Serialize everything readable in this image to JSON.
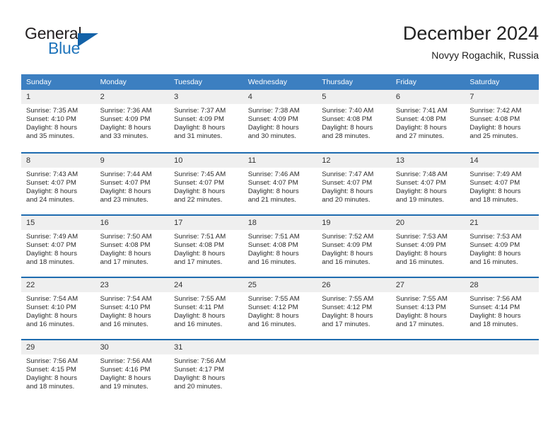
{
  "brand": {
    "name_top": "General",
    "name_bottom": "Blue",
    "accent_color": "#1f74bb",
    "triangle_color": "#1362a8"
  },
  "header": {
    "title": "December 2024",
    "subtitle": "Novyy Rogachik, Russia"
  },
  "theme": {
    "header_row_bg": "#3c7fc1",
    "week_divider": "#1f6cb0",
    "daynum_bg": "#efefef",
    "text": "#2b2b2b"
  },
  "weekdays": [
    "Sunday",
    "Monday",
    "Tuesday",
    "Wednesday",
    "Thursday",
    "Friday",
    "Saturday"
  ],
  "weeks": [
    [
      {
        "day": "1",
        "sunrise": "Sunrise: 7:35 AM",
        "sunset": "Sunset: 4:10 PM",
        "daylight1": "Daylight: 8 hours",
        "daylight2": "and 35 minutes."
      },
      {
        "day": "2",
        "sunrise": "Sunrise: 7:36 AM",
        "sunset": "Sunset: 4:09 PM",
        "daylight1": "Daylight: 8 hours",
        "daylight2": "and 33 minutes."
      },
      {
        "day": "3",
        "sunrise": "Sunrise: 7:37 AM",
        "sunset": "Sunset: 4:09 PM",
        "daylight1": "Daylight: 8 hours",
        "daylight2": "and 31 minutes."
      },
      {
        "day": "4",
        "sunrise": "Sunrise: 7:38 AM",
        "sunset": "Sunset: 4:09 PM",
        "daylight1": "Daylight: 8 hours",
        "daylight2": "and 30 minutes."
      },
      {
        "day": "5",
        "sunrise": "Sunrise: 7:40 AM",
        "sunset": "Sunset: 4:08 PM",
        "daylight1": "Daylight: 8 hours",
        "daylight2": "and 28 minutes."
      },
      {
        "day": "6",
        "sunrise": "Sunrise: 7:41 AM",
        "sunset": "Sunset: 4:08 PM",
        "daylight1": "Daylight: 8 hours",
        "daylight2": "and 27 minutes."
      },
      {
        "day": "7",
        "sunrise": "Sunrise: 7:42 AM",
        "sunset": "Sunset: 4:08 PM",
        "daylight1": "Daylight: 8 hours",
        "daylight2": "and 25 minutes."
      }
    ],
    [
      {
        "day": "8",
        "sunrise": "Sunrise: 7:43 AM",
        "sunset": "Sunset: 4:07 PM",
        "daylight1": "Daylight: 8 hours",
        "daylight2": "and 24 minutes."
      },
      {
        "day": "9",
        "sunrise": "Sunrise: 7:44 AM",
        "sunset": "Sunset: 4:07 PM",
        "daylight1": "Daylight: 8 hours",
        "daylight2": "and 23 minutes."
      },
      {
        "day": "10",
        "sunrise": "Sunrise: 7:45 AM",
        "sunset": "Sunset: 4:07 PM",
        "daylight1": "Daylight: 8 hours",
        "daylight2": "and 22 minutes."
      },
      {
        "day": "11",
        "sunrise": "Sunrise: 7:46 AM",
        "sunset": "Sunset: 4:07 PM",
        "daylight1": "Daylight: 8 hours",
        "daylight2": "and 21 minutes."
      },
      {
        "day": "12",
        "sunrise": "Sunrise: 7:47 AM",
        "sunset": "Sunset: 4:07 PM",
        "daylight1": "Daylight: 8 hours",
        "daylight2": "and 20 minutes."
      },
      {
        "day": "13",
        "sunrise": "Sunrise: 7:48 AM",
        "sunset": "Sunset: 4:07 PM",
        "daylight1": "Daylight: 8 hours",
        "daylight2": "and 19 minutes."
      },
      {
        "day": "14",
        "sunrise": "Sunrise: 7:49 AM",
        "sunset": "Sunset: 4:07 PM",
        "daylight1": "Daylight: 8 hours",
        "daylight2": "and 18 minutes."
      }
    ],
    [
      {
        "day": "15",
        "sunrise": "Sunrise: 7:49 AM",
        "sunset": "Sunset: 4:07 PM",
        "daylight1": "Daylight: 8 hours",
        "daylight2": "and 18 minutes."
      },
      {
        "day": "16",
        "sunrise": "Sunrise: 7:50 AM",
        "sunset": "Sunset: 4:08 PM",
        "daylight1": "Daylight: 8 hours",
        "daylight2": "and 17 minutes."
      },
      {
        "day": "17",
        "sunrise": "Sunrise: 7:51 AM",
        "sunset": "Sunset: 4:08 PM",
        "daylight1": "Daylight: 8 hours",
        "daylight2": "and 17 minutes."
      },
      {
        "day": "18",
        "sunrise": "Sunrise: 7:51 AM",
        "sunset": "Sunset: 4:08 PM",
        "daylight1": "Daylight: 8 hours",
        "daylight2": "and 16 minutes."
      },
      {
        "day": "19",
        "sunrise": "Sunrise: 7:52 AM",
        "sunset": "Sunset: 4:09 PM",
        "daylight1": "Daylight: 8 hours",
        "daylight2": "and 16 minutes."
      },
      {
        "day": "20",
        "sunrise": "Sunrise: 7:53 AM",
        "sunset": "Sunset: 4:09 PM",
        "daylight1": "Daylight: 8 hours",
        "daylight2": "and 16 minutes."
      },
      {
        "day": "21",
        "sunrise": "Sunrise: 7:53 AM",
        "sunset": "Sunset: 4:09 PM",
        "daylight1": "Daylight: 8 hours",
        "daylight2": "and 16 minutes."
      }
    ],
    [
      {
        "day": "22",
        "sunrise": "Sunrise: 7:54 AM",
        "sunset": "Sunset: 4:10 PM",
        "daylight1": "Daylight: 8 hours",
        "daylight2": "and 16 minutes."
      },
      {
        "day": "23",
        "sunrise": "Sunrise: 7:54 AM",
        "sunset": "Sunset: 4:10 PM",
        "daylight1": "Daylight: 8 hours",
        "daylight2": "and 16 minutes."
      },
      {
        "day": "24",
        "sunrise": "Sunrise: 7:55 AM",
        "sunset": "Sunset: 4:11 PM",
        "daylight1": "Daylight: 8 hours",
        "daylight2": "and 16 minutes."
      },
      {
        "day": "25",
        "sunrise": "Sunrise: 7:55 AM",
        "sunset": "Sunset: 4:12 PM",
        "daylight1": "Daylight: 8 hours",
        "daylight2": "and 16 minutes."
      },
      {
        "day": "26",
        "sunrise": "Sunrise: 7:55 AM",
        "sunset": "Sunset: 4:12 PM",
        "daylight1": "Daylight: 8 hours",
        "daylight2": "and 17 minutes."
      },
      {
        "day": "27",
        "sunrise": "Sunrise: 7:55 AM",
        "sunset": "Sunset: 4:13 PM",
        "daylight1": "Daylight: 8 hours",
        "daylight2": "and 17 minutes."
      },
      {
        "day": "28",
        "sunrise": "Sunrise: 7:56 AM",
        "sunset": "Sunset: 4:14 PM",
        "daylight1": "Daylight: 8 hours",
        "daylight2": "and 18 minutes."
      }
    ],
    [
      {
        "day": "29",
        "sunrise": "Sunrise: 7:56 AM",
        "sunset": "Sunset: 4:15 PM",
        "daylight1": "Daylight: 8 hours",
        "daylight2": "and 18 minutes."
      },
      {
        "day": "30",
        "sunrise": "Sunrise: 7:56 AM",
        "sunset": "Sunset: 4:16 PM",
        "daylight1": "Daylight: 8 hours",
        "daylight2": "and 19 minutes."
      },
      {
        "day": "31",
        "sunrise": "Sunrise: 7:56 AM",
        "sunset": "Sunset: 4:17 PM",
        "daylight1": "Daylight: 8 hours",
        "daylight2": "and 20 minutes."
      },
      {
        "day": "",
        "sunrise": "",
        "sunset": "",
        "daylight1": "",
        "daylight2": ""
      },
      {
        "day": "",
        "sunrise": "",
        "sunset": "",
        "daylight1": "",
        "daylight2": ""
      },
      {
        "day": "",
        "sunrise": "",
        "sunset": "",
        "daylight1": "",
        "daylight2": ""
      },
      {
        "day": "",
        "sunrise": "",
        "sunset": "",
        "daylight1": "",
        "daylight2": ""
      }
    ]
  ]
}
